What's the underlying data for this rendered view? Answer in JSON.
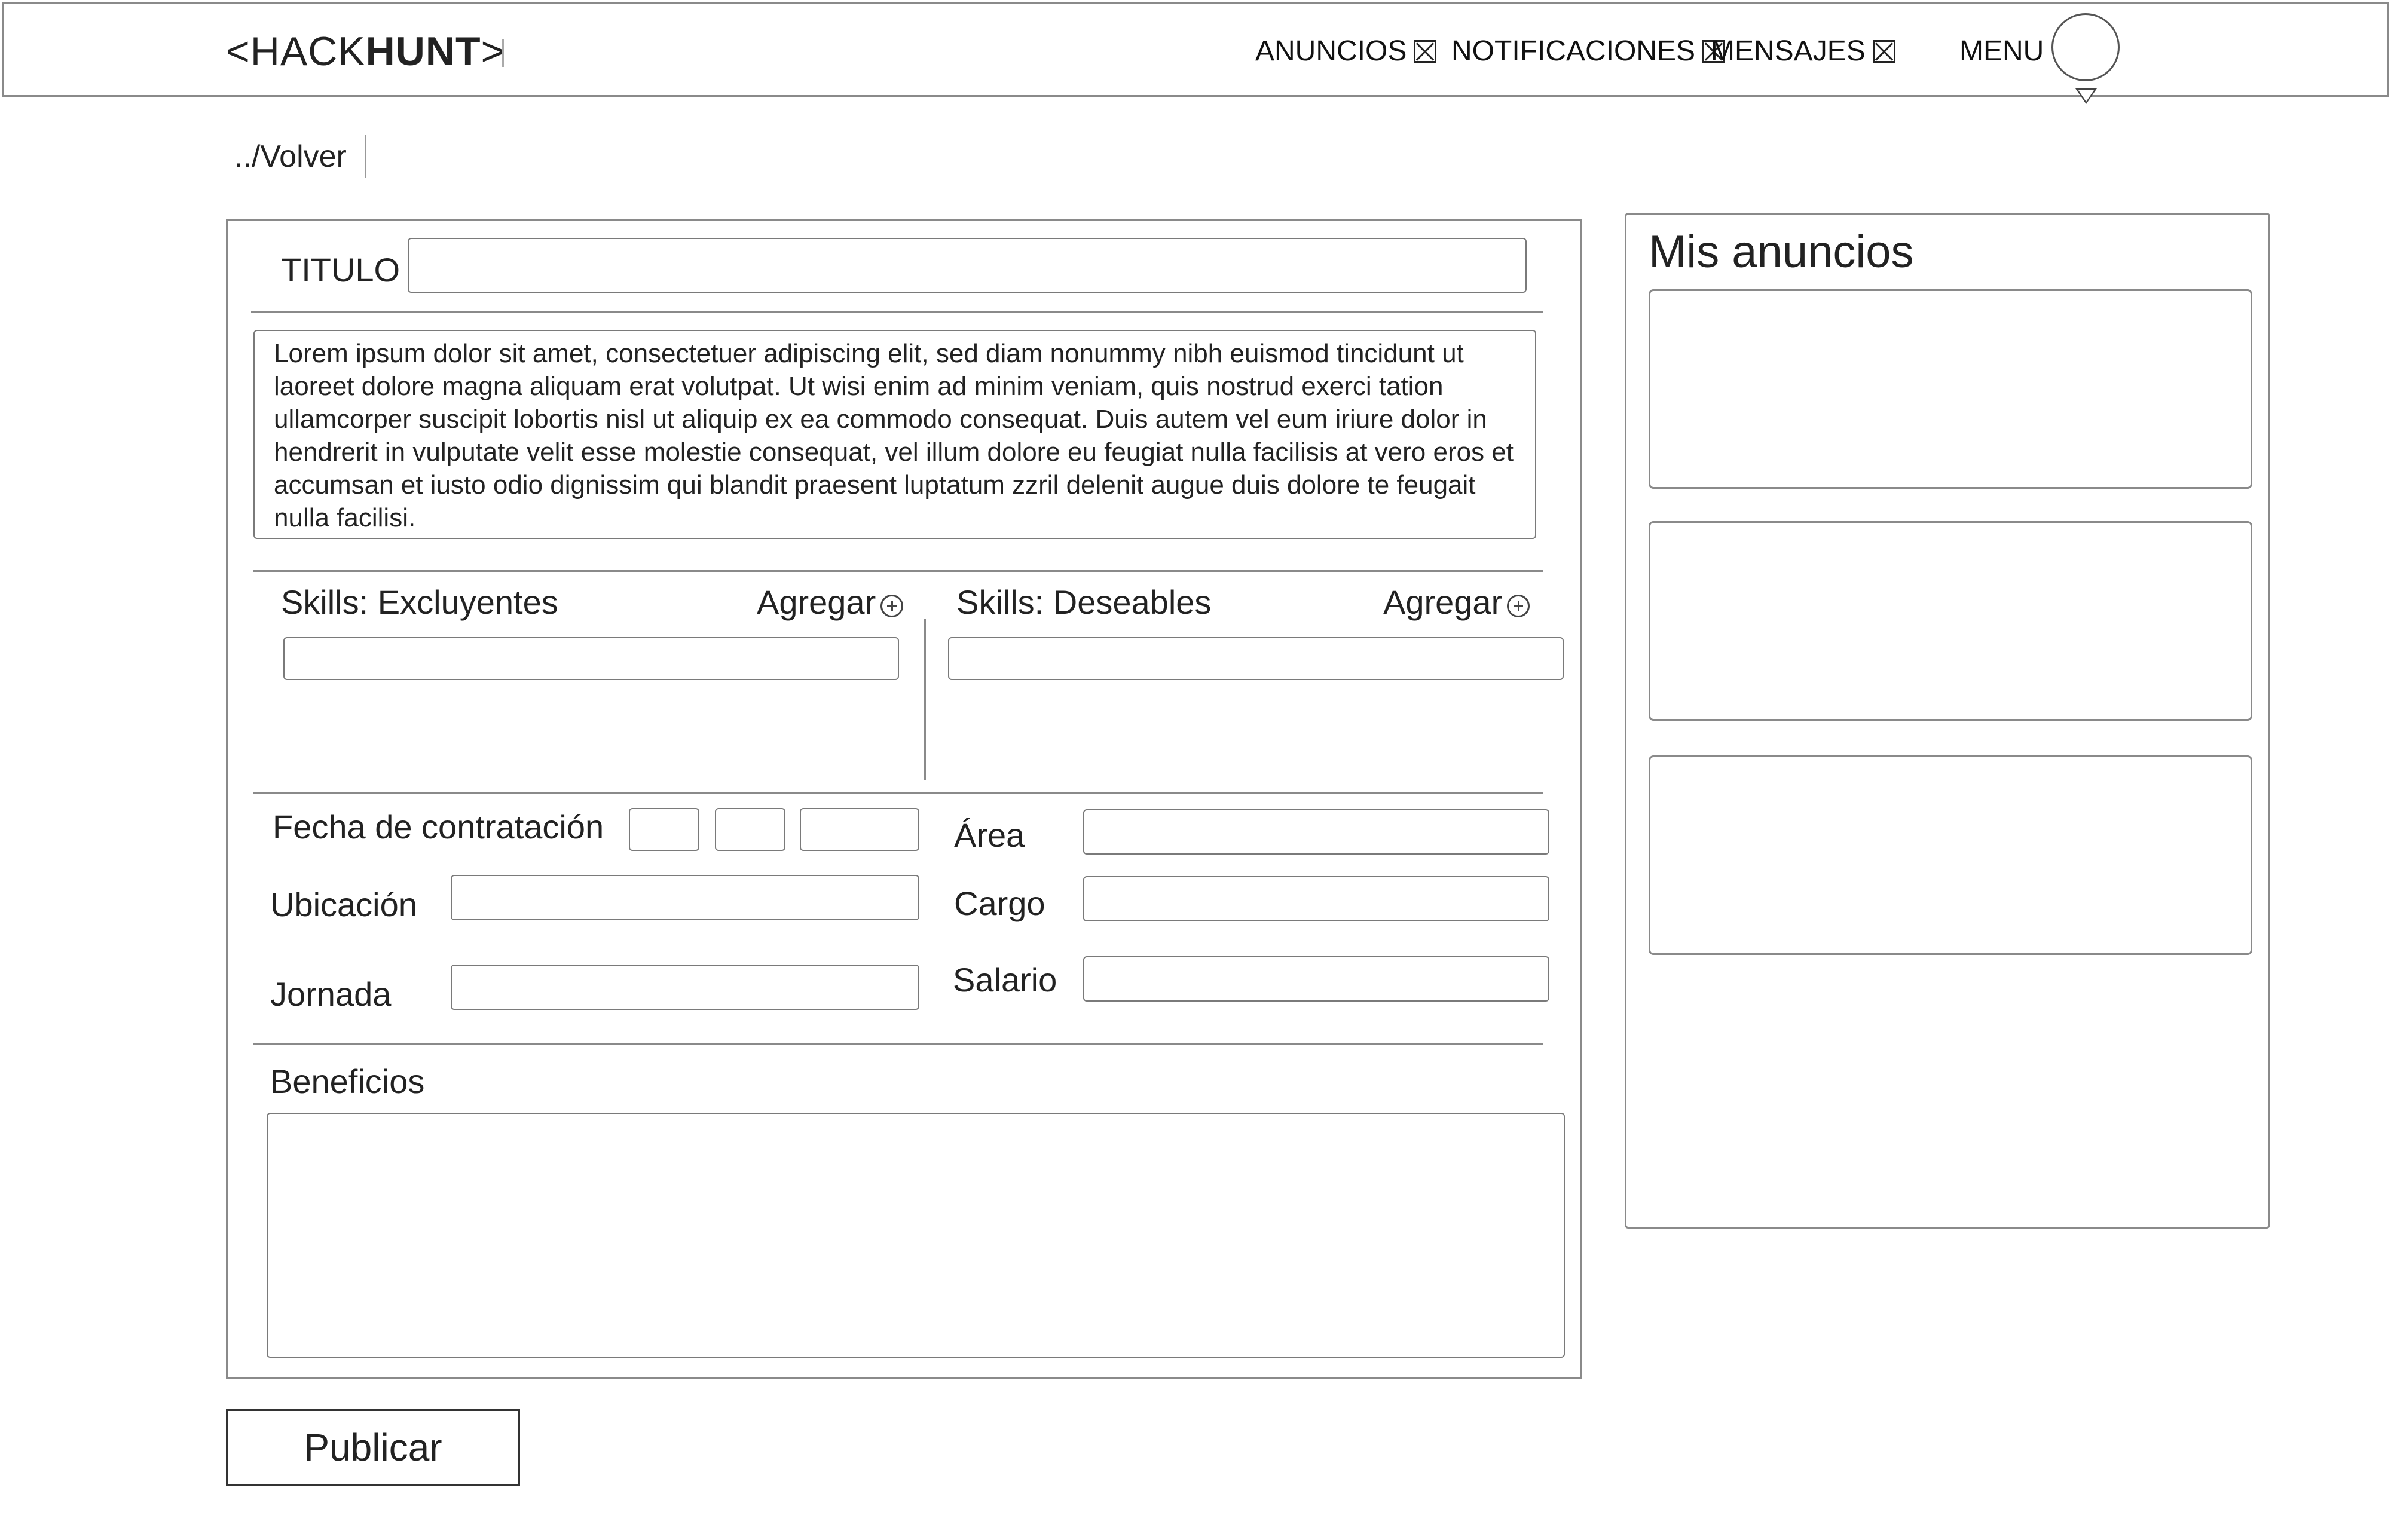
{
  "header": {
    "logo_open": "<",
    "logo_hack": "HACK",
    "logo_hunt": "HUNT",
    "logo_close": ">",
    "nav": {
      "anuncios": "ANUNCIOS",
      "notificaciones": "NOTIFICACIONES",
      "mensajes": "MENSAJES",
      "menu": "MENU"
    }
  },
  "back_link": "../Volver",
  "form": {
    "title_label": "TITULO",
    "title_value": "",
    "description": "Lorem ipsum dolor sit amet, consectetuer adipiscing elit, sed diam nonummy nibh euismod tincidunt ut laoreet dolore magna aliquam erat volutpat. Ut wisi enim ad minim veniam, quis nostrud exerci tation ullamcorper suscipit lobortis nisl ut aliquip ex ea commodo consequat. Duis autem vel eum iriure dolor in hendrerit in vulputate velit esse molestie consequat, vel illum dolore eu feugiat nulla facilisis at vero eros et accumsan et iusto odio dignissim qui blandit praesent luptatum zzril delenit augue duis dolore te feugait nulla facilisi.",
    "skills_required_label": "Skills: Excluyentes",
    "skills_desired_label": "Skills: Deseables",
    "add_label": "Agregar",
    "hire_date_label": "Fecha de contratación",
    "location_label": "Ubicación",
    "workday_label": "Jornada",
    "area_label": "Área",
    "position_label": "Cargo",
    "salary_label": "Salario",
    "benefits_label": "Beneficios",
    "publish_button": "Publicar"
  },
  "my_ads": {
    "title": "Mis anuncios",
    "cards": [
      "",
      "",
      ""
    ]
  },
  "icons": {
    "nav_badge": "x-box-icon",
    "add": "plus-circle-icon",
    "avatar": "avatar-circle-icon",
    "menu_caret": "triangle-down-icon"
  }
}
